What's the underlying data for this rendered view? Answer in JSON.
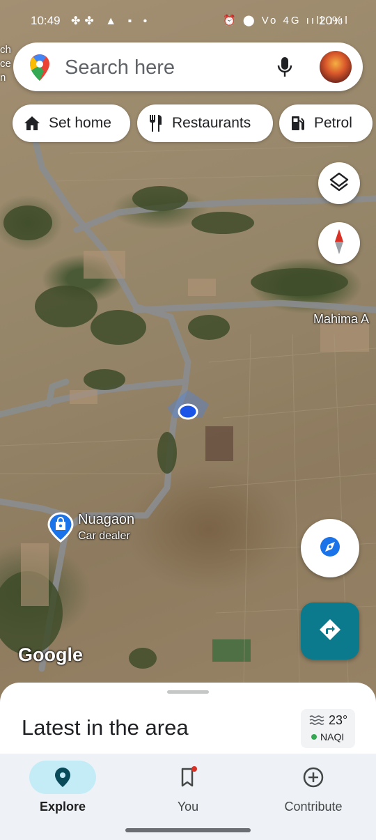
{
  "status_bar": {
    "time": "10:49",
    "left_icons": "✤✤ ▲ ▪ •",
    "right_icons": "⏰ ⬤ Vo 4G ııll ıııl",
    "battery": "20%"
  },
  "search": {
    "placeholder": "Search here",
    "mic_icon": "mic-icon",
    "avatar_icon": "profile-avatar"
  },
  "chips": [
    {
      "label": "Set home",
      "icon": "home-icon"
    },
    {
      "label": "Restaurants",
      "icon": "restaurant-icon"
    },
    {
      "label": "Petrol",
      "icon": "fuel-icon"
    }
  ],
  "map": {
    "left_edge_labels": [
      "ch",
      "ce",
      "n"
    ],
    "road_label": "Mahima A",
    "place": {
      "name": "Nuagaon",
      "category": "Car dealer",
      "icon": "car-dealer-pin-icon"
    },
    "attribution": "Google"
  },
  "sheet": {
    "title": "Latest in the area",
    "temperature": "23°",
    "air_quality": "NAQI"
  },
  "bottom_nav": [
    {
      "label": "Explore",
      "icon": "location-pin-icon",
      "active": true
    },
    {
      "label": "You",
      "icon": "bookmark-icon",
      "active": false
    },
    {
      "label": "Contribute",
      "icon": "add-circle-icon",
      "active": false
    }
  ],
  "colors": {
    "accent_blue": "#1a73e8",
    "directions_teal": "#0b7a8c",
    "nav_active_pill": "#c4ecf7"
  }
}
